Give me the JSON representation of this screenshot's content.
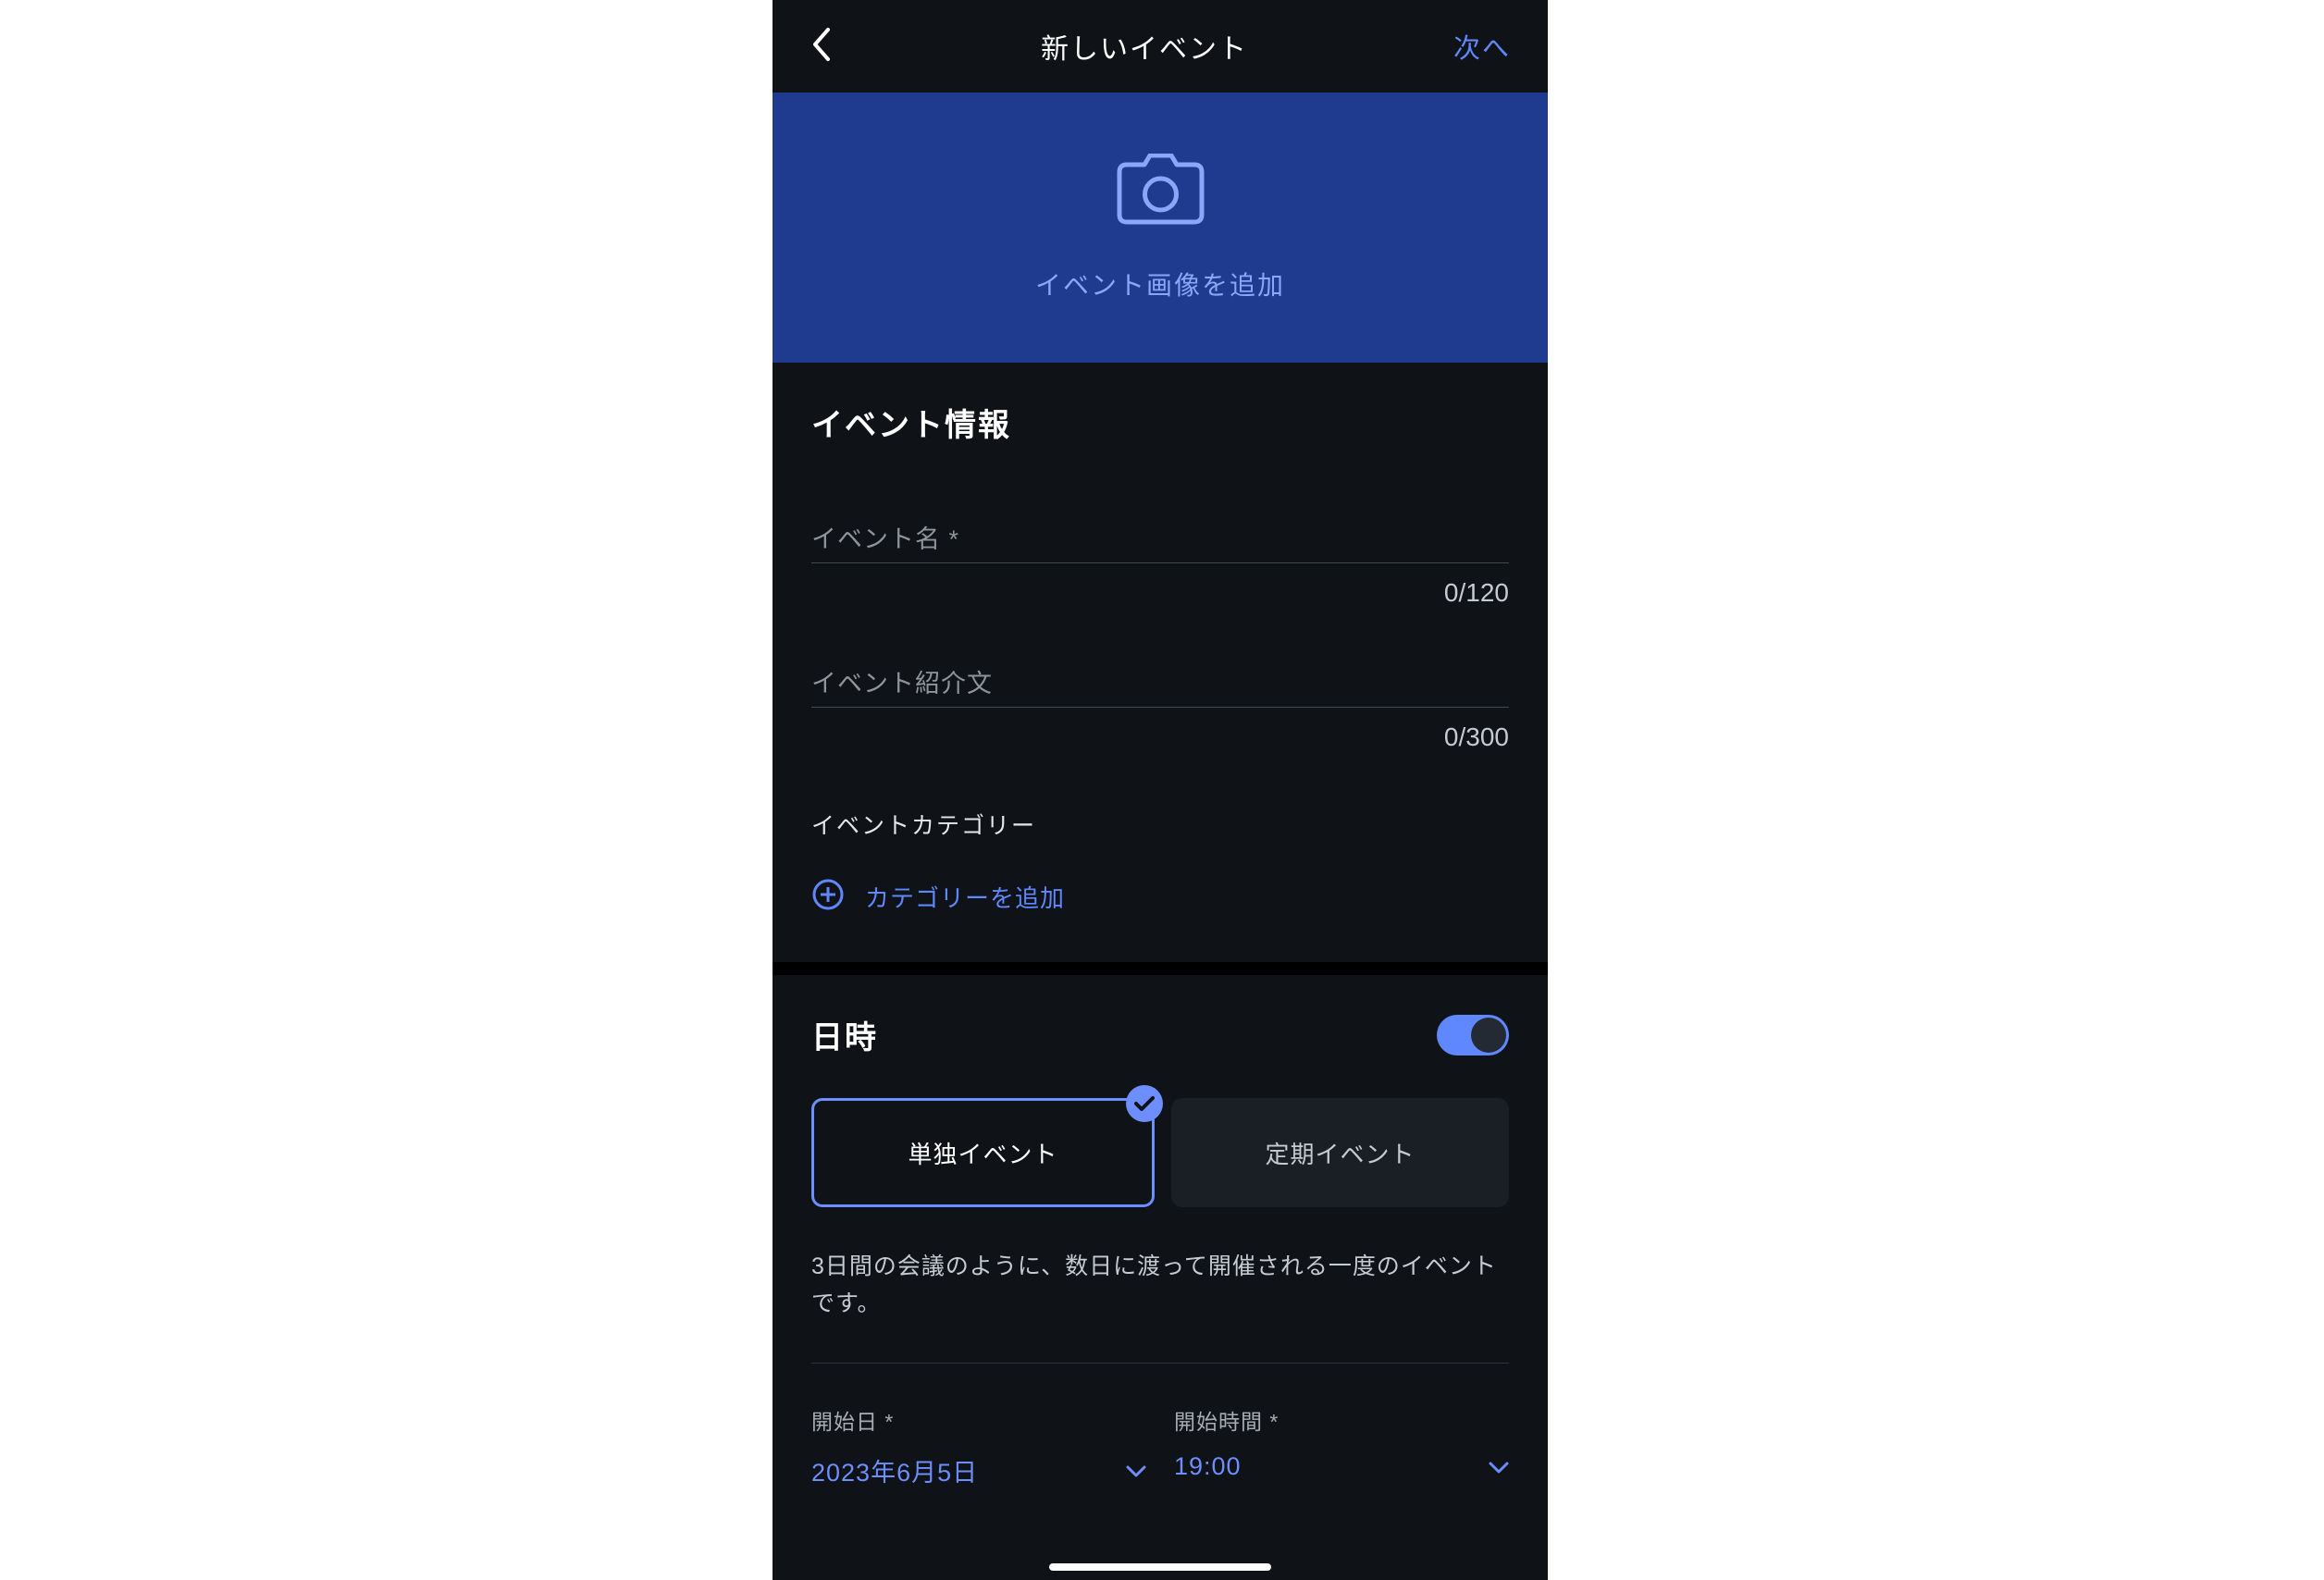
{
  "header": {
    "title": "新しいイベント",
    "next_label": "次へ"
  },
  "image_upload": {
    "label": "イベント画像を追加"
  },
  "event_info": {
    "section_title": "イベント情報",
    "name_placeholder": "イベント名 *",
    "name_counter": "0/120",
    "desc_placeholder": "イベント紹介文",
    "desc_counter": "0/300",
    "category_heading": "イベントカテゴリー",
    "add_category_label": "カテゴリーを追加"
  },
  "datetime": {
    "section_title": "日時",
    "toggle_on": true,
    "type_options": {
      "single": "単独イベント",
      "recurring": "定期イベント"
    },
    "type_description": "3日間の会議のように、数日に渡って開催される一度のイベントです。",
    "start_date_label": "開始日 *",
    "start_date_value": "2023年6月5日",
    "start_time_label": "開始時間 *",
    "start_time_value": "19:00"
  }
}
